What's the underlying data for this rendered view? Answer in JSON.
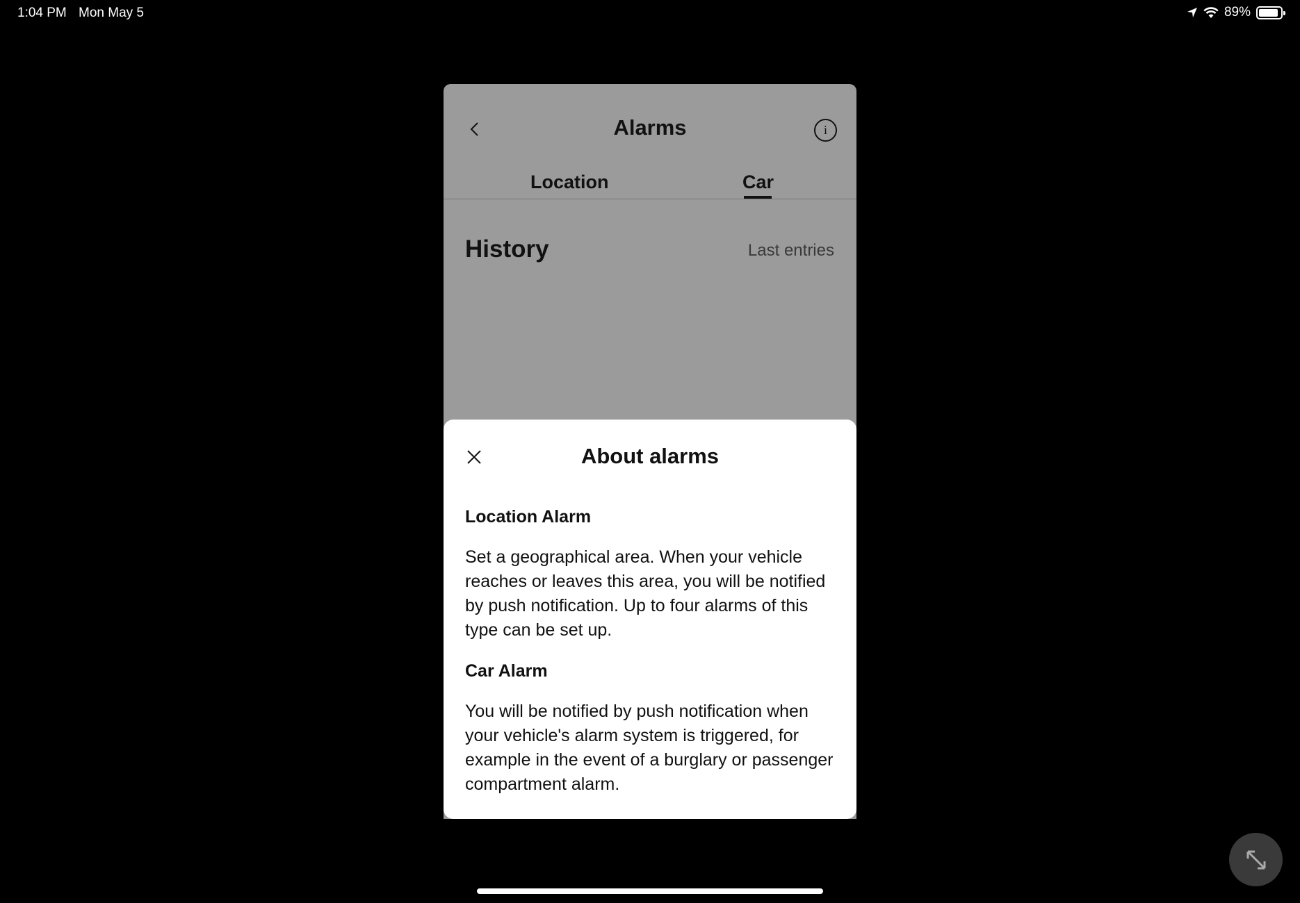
{
  "status_bar": {
    "time": "1:04 PM",
    "date": "Mon May 5",
    "battery_percent": "89%",
    "battery_level": 0.89,
    "icons": [
      "location-arrow-icon",
      "wifi-icon",
      "battery-icon"
    ]
  },
  "app": {
    "title": "Alarms",
    "back_icon": "chevron-left-icon",
    "info_icon": "info-icon",
    "info_glyph": "i",
    "tabs": [
      {
        "label": "Location",
        "selected": false
      },
      {
        "label": "Car",
        "selected": true
      }
    ],
    "history_title": "History",
    "history_subtitle": "Last entries"
  },
  "sheet": {
    "title": "About alarms",
    "close_icon": "close-icon",
    "sections": [
      {
        "heading": "Location Alarm",
        "body": "Set a geographical area. When your vehicle reaches or leaves this area, you will be notified by push notification. Up to four alarms of this type can be set up."
      },
      {
        "heading": "Car Alarm",
        "body": "You will be notified by push notification when your vehicle's alarm system is triggered, for example in the event of a burglary or passenger compartment alarm."
      }
    ]
  },
  "overlay": {
    "expand_icon": "expand-arrows-icon"
  },
  "colors": {
    "background": "#000000",
    "app_dimmed": "#9b9b9b",
    "sheet": "#ffffff",
    "text": "#111111"
  }
}
